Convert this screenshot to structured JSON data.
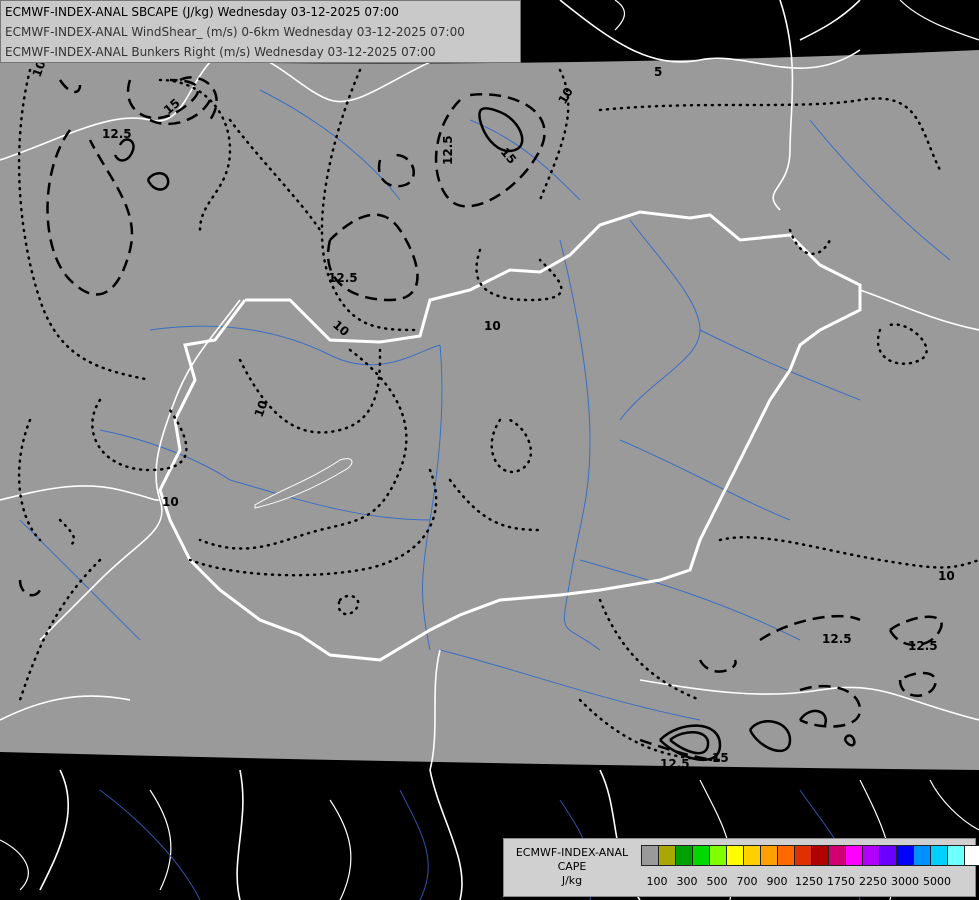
{
  "header": {
    "line1": "ECMWF-INDEX-ANAL SBCAPE (J/kg) Wednesday 03-12-2025 07:00",
    "line2": "ECMWF-INDEX-ANAL WindShear_ (m/s) 0-6km Wednesday 03-12-2025 07:00",
    "line3": "ECMWF-INDEX-ANAL Bunkers Right (m/s) Wednesday 03-12-2025 07:00"
  },
  "contour_labels": [
    "5",
    "10",
    "12.5",
    "15",
    "10",
    "12.5",
    "15",
    "12.5",
    "10",
    "10",
    "10",
    "10",
    "10",
    "12.5",
    "12.5",
    "12.5",
    "15"
  ],
  "legend": {
    "title_line1": "ECMWF-INDEX-ANAL",
    "title_line2": "CAPE",
    "title_line3": "J/kg",
    "colors": [
      "#9a9a9a",
      "#a8a800",
      "#00a000",
      "#00d800",
      "#80ff00",
      "#ffff00",
      "#ffd000",
      "#ffa000",
      "#ff6a00",
      "#e03000",
      "#b00000",
      "#d00070",
      "#ff00ff",
      "#b000ff",
      "#6a00ff",
      "#0000ff",
      "#0090ff",
      "#00d0ff",
      "#70ffff",
      "#ffffff"
    ],
    "ticks": [
      "100",
      "300",
      "500",
      "700",
      "900",
      "1250",
      "1750",
      "2250",
      "3000",
      "5000"
    ]
  },
  "colors": {
    "domain_fill": "#9a9a9a",
    "outside": "#000000",
    "border": "#ffffff",
    "rivers": "#3b6fc4"
  }
}
